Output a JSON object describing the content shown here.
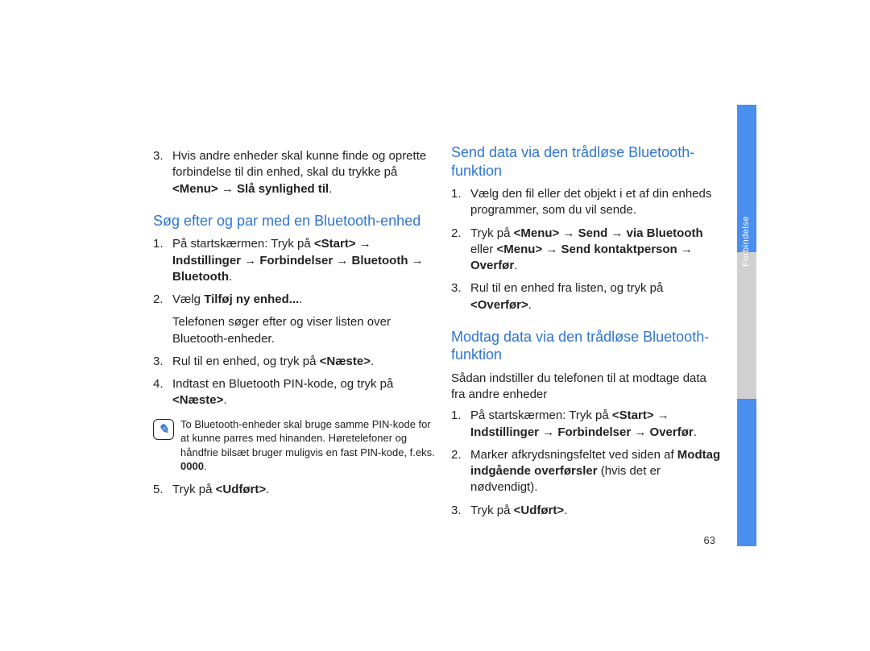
{
  "page_number": "63",
  "sidebar_label": "Forbindelse",
  "left": {
    "item3_text": "Hvis andre enheder skal kunne finde og oprette forbindelse til din enhed, skal du trykke på ",
    "item3_menu_seq": "<Menu> → Slå synlighed til",
    "heading": "Søg efter og par med en Bluetooth-enhed",
    "s1_pre": "På startskærmen: Tryk på ",
    "s1_seq": "<Start> → Indstillinger → Forbindelser → Bluetooth → Bluetooth",
    "s2_pre": "Vælg ",
    "s2_bold": "Tilføj ny enhed...",
    "s2_sub": "Telefonen søger efter og viser listen over Bluetooth-enheder.",
    "s3_pre": "Rul til en enhed, og tryk på ",
    "s3_bold": "<Næste>",
    "s4_pre": "Indtast en Bluetooth PIN-kode, og tryk på ",
    "s4_bold": "<Næste>",
    "note_text_pre": "To Bluetooth-enheder skal bruge samme PIN-kode for at kunne parres med hinanden. Høretelefoner og håndfrie bilsæt bruger muligvis en fast PIN-kode, f.eks. ",
    "note_bold": "0000",
    "s5_pre": "Tryk på ",
    "s5_bold": "<Udført>"
  },
  "right": {
    "heading_send": "Send data via den trådløse Bluetooth-funktion",
    "send1": "Vælg den fil eller det objekt i et af din enheds programmer, som du vil sende.",
    "send2_pre": "Tryk på ",
    "send2_seq1": "<Menu> → Send → via Bluetooth",
    "send2_mid": " eller ",
    "send2_seq2": "<Menu> → Send kontaktperson → Overfør",
    "send3_pre": "Rul til en enhed fra listen, og tryk på ",
    "send3_bold": "<Overfør>",
    "heading_recv": "Modtag data via den trådløse Bluetooth-funktion",
    "recv_intro": "Sådan indstiller du telefonen til at modtage data fra andre enheder",
    "r1_pre": "På startskærmen: Tryk på ",
    "r1_seq": "<Start> → Indstillinger → Forbindelser → Overfør",
    "r2_pre": "Marker afkrydsningsfeltet ved siden af ",
    "r2_bold": "Modtag indgående overførsler",
    "r2_post": " (hvis det er nødvendigt).",
    "r3_pre": "Tryk på ",
    "r3_bold": "<Udført>"
  }
}
